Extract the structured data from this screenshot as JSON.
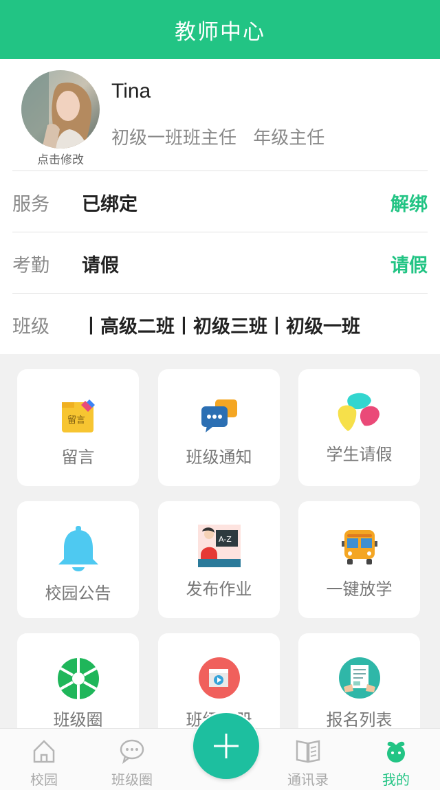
{
  "header": {
    "title": "教师中心"
  },
  "profile": {
    "avatar_hint": "点击修改",
    "name": "Tina",
    "roles": [
      "初级一班班主任",
      "年级主任"
    ]
  },
  "info": {
    "rows": [
      {
        "label": "服务",
        "value": "已绑定",
        "action": "解绑"
      },
      {
        "label": "考勤",
        "value": "请假",
        "action": "请假"
      },
      {
        "label": "班级",
        "value": "丨高级二班丨初级三班丨初级一班",
        "action": ""
      }
    ]
  },
  "grid": {
    "items": [
      {
        "label": "留言",
        "icon": "message-note-icon"
      },
      {
        "label": "班级通知",
        "icon": "chat-bubbles-icon"
      },
      {
        "label": "学生请假",
        "icon": "colorful-petals-icon"
      },
      {
        "label": "校园公告",
        "icon": "bell-icon"
      },
      {
        "label": "发布作业",
        "icon": "teacher-blackboard-icon"
      },
      {
        "label": "一键放学",
        "icon": "school-bus-icon"
      },
      {
        "label": "班级圈",
        "icon": "aperture-icon"
      },
      {
        "label": "班级相册",
        "icon": "video-camera-icon"
      },
      {
        "label": "报名列表",
        "icon": "signup-form-icon"
      }
    ]
  },
  "tabbar": {
    "items": [
      {
        "label": "校园",
        "icon": "home-icon",
        "active": false
      },
      {
        "label": "班级圈",
        "icon": "chat-icon",
        "active": false
      },
      {
        "label": "",
        "icon": "plus-icon",
        "active": false
      },
      {
        "label": "通讯录",
        "icon": "book-icon",
        "active": false
      },
      {
        "label": "我的",
        "icon": "sprout-icon",
        "active": true
      }
    ]
  },
  "colors": {
    "accent": "#22c484",
    "plus_button": "#1dbf9f"
  }
}
